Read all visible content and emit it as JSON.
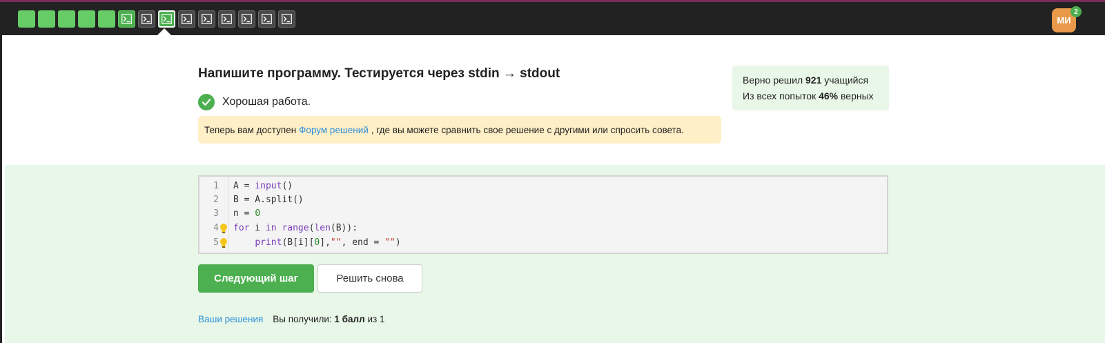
{
  "topbar": {
    "steps": [
      {
        "type": "text",
        "passed": true,
        "current": false
      },
      {
        "type": "text",
        "passed": true,
        "current": false
      },
      {
        "type": "text",
        "passed": true,
        "current": false
      },
      {
        "type": "text",
        "passed": true,
        "current": false
      },
      {
        "type": "text",
        "passed": true,
        "current": false
      },
      {
        "type": "code",
        "passed": true,
        "current": false
      },
      {
        "type": "code",
        "passed": false,
        "current": false
      },
      {
        "type": "code",
        "passed": true,
        "current": true
      },
      {
        "type": "code",
        "passed": false,
        "current": false
      },
      {
        "type": "code",
        "passed": false,
        "current": false
      },
      {
        "type": "code",
        "passed": false,
        "current": false
      },
      {
        "type": "code",
        "passed": false,
        "current": false
      },
      {
        "type": "code",
        "passed": false,
        "current": false
      },
      {
        "type": "code",
        "passed": false,
        "current": false
      }
    ],
    "avatar_initials": "МИ",
    "notification_count": "2"
  },
  "task": {
    "title": "Напишите программу. Тестируется через stdin → stdout",
    "status_text": "Хорошая работа.",
    "notice": {
      "prefix": "Теперь вам доступен",
      "link": "Форум решений",
      "suffix": ", где вы можете сравнить свое решение с другими или спросить совета."
    }
  },
  "stats": {
    "line1_prefix": "Верно решил",
    "solved_count": "921",
    "line1_suffix": "учащийся",
    "line2_prefix": "Из всех попыток",
    "correct_percent": "46%",
    "line2_suffix": "верных"
  },
  "editor": {
    "line_numbers": [
      "1",
      "2",
      "3",
      "4",
      "5"
    ],
    "hint_lines": [
      4,
      5
    ]
  },
  "buttons": {
    "next": "Следующий шаг",
    "retry": "Решить снова"
  },
  "footer": {
    "solutions_link": "Ваши решения",
    "score_prefix": "Вы получили:",
    "score_value": "1 балл",
    "score_suffix": "из 1"
  },
  "colors": {
    "topbar": "#222222",
    "accent_green": "#4caf50",
    "passed_step": "#66cc66",
    "notice_bg": "#ffefc6",
    "success_bg": "#e8f7e8",
    "link": "#2e8fd8",
    "avatar": "#e89a4a"
  }
}
